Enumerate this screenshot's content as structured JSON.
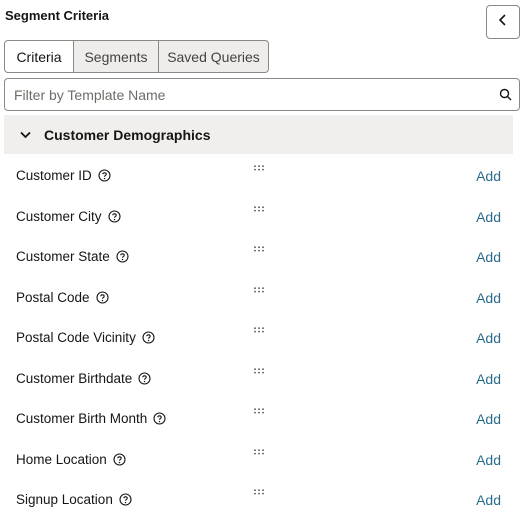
{
  "panel": {
    "title": "Segment Criteria"
  },
  "tabs": [
    {
      "label": "Criteria",
      "active": true
    },
    {
      "label": "Segments",
      "active": false
    },
    {
      "label": "Saved Queries",
      "active": false
    }
  ],
  "filter": {
    "placeholder": "Filter by Template Name",
    "value": ""
  },
  "group": {
    "label": "Customer Demographics",
    "expanded": true
  },
  "items": [
    {
      "label": "Customer ID",
      "action": "Add"
    },
    {
      "label": "Customer City",
      "action": "Add"
    },
    {
      "label": "Customer State",
      "action": "Add"
    },
    {
      "label": "Postal Code",
      "action": "Add"
    },
    {
      "label": "Postal Code Vicinity",
      "action": "Add"
    },
    {
      "label": "Customer Birthdate",
      "action": "Add"
    },
    {
      "label": "Customer Birth Month",
      "action": "Add"
    },
    {
      "label": "Home Location",
      "action": "Add"
    },
    {
      "label": "Signup Location",
      "action": "Add"
    }
  ],
  "colors": {
    "accent_link": "#2b6c8c",
    "header_bg": "#f1efed",
    "border": "#8b8985"
  },
  "icons": {
    "collapse": "chevron-left-icon",
    "search": "search-icon",
    "group_toggle": "chevron-down-icon",
    "help": "help-circle-icon",
    "drag": "drag-handle-icon"
  }
}
